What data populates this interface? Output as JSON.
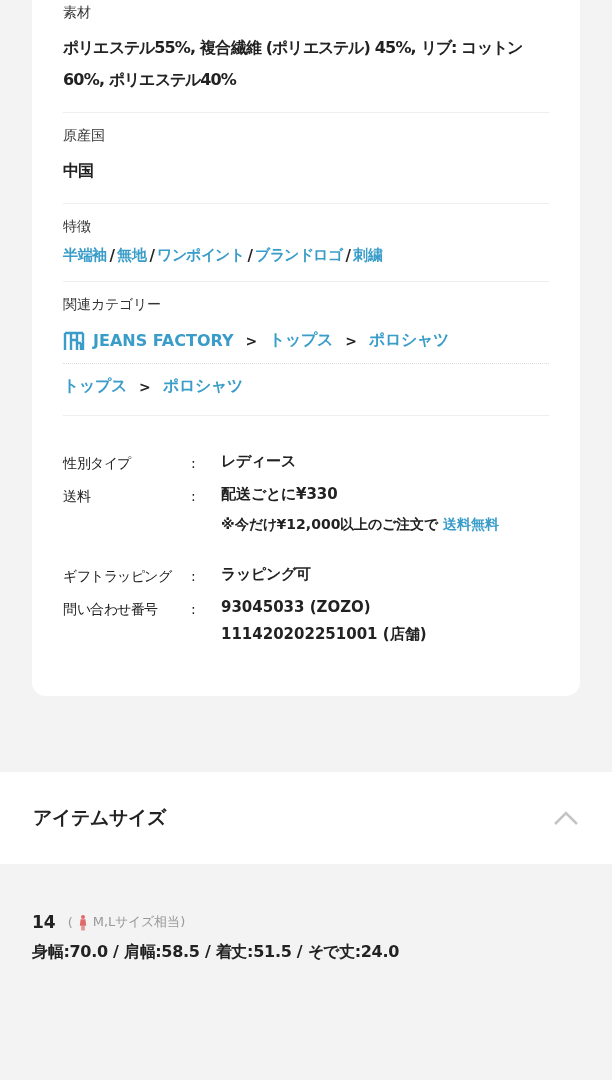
{
  "details": [
    {
      "label": "素材",
      "value": "ポリエステル55%, 複合繊維 (ポリエステル) 45%, リブ: コットン60%, ポリエステル40%"
    },
    {
      "label": "原産国",
      "value": "中国"
    }
  ],
  "features": {
    "label": "特徴",
    "separator": "/",
    "tags": [
      "半端袖",
      "無地",
      "ワンポイント",
      "ブランドロゴ",
      "刺繍"
    ]
  },
  "related": {
    "label": "関連カテゴリー",
    "separator": ">",
    "paths": [
      [
        {
          "text": "JEANS FACTORY",
          "kind": "shop"
        },
        {
          "text": "トップス",
          "kind": "link"
        },
        {
          "text": "ポロシャツ",
          "kind": "link"
        }
      ],
      [
        {
          "text": "トップス",
          "kind": "link"
        },
        {
          "text": "ポロシャツ",
          "kind": "link"
        }
      ]
    ]
  },
  "info_colon": ":",
  "info": [
    {
      "label": "性別タイプ",
      "values": [
        "レディース"
      ]
    },
    {
      "label": "送料",
      "values": [
        "配送ごとに¥330"
      ],
      "note": "※今だけ¥12,000以上のご注文で",
      "note_link": "送料無料"
    },
    {
      "label": "ギフトラッピング",
      "values": [
        "ラッピング可"
      ]
    },
    {
      "label": "問い合わせ番号",
      "values": [
        "93045033 (ZOZO)",
        "111420202251001 (店舗)"
      ]
    }
  ],
  "item_size": {
    "title": "アイテムサイズ",
    "expanded": true,
    "size": "14",
    "open": "(",
    "equiv": "M,Lサイズ相当)",
    "measures": "身幅:70.0 / 肩幅:58.5 / 着丈:51.5 / そで丈:24.0"
  }
}
